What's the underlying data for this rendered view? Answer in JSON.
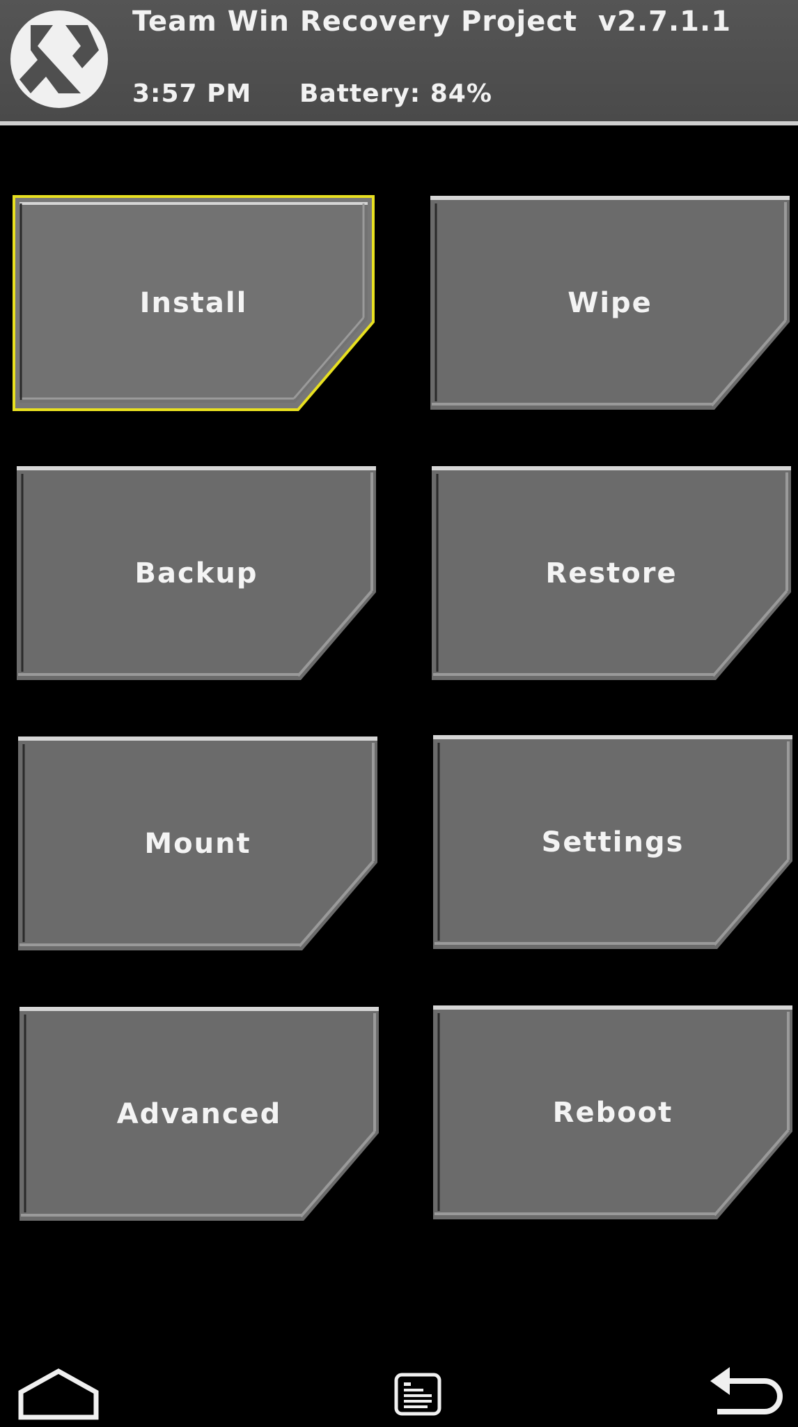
{
  "header": {
    "title": "Team Win Recovery Project  v2.7.1.1",
    "time": "3:57 PM",
    "battery": "Battery: 84%"
  },
  "tiles": [
    {
      "label": "Install",
      "selected": true
    },
    {
      "label": "Wipe",
      "selected": false
    },
    {
      "label": "Backup",
      "selected": false
    },
    {
      "label": "Restore",
      "selected": false
    },
    {
      "label": "Mount",
      "selected": false
    },
    {
      "label": "Settings",
      "selected": false
    },
    {
      "label": "Advanced",
      "selected": false
    },
    {
      "label": "Reboot",
      "selected": false
    }
  ],
  "navbar": {
    "home_icon": "home-icon",
    "console_icon": "console-icon",
    "back_icon": "back-icon"
  },
  "colors": {
    "tile_fill": "#6b6b6b",
    "tile_highlight": "#d6d6d6",
    "selected_border": "#e8e020",
    "header_bg": "#4f4f4f"
  }
}
